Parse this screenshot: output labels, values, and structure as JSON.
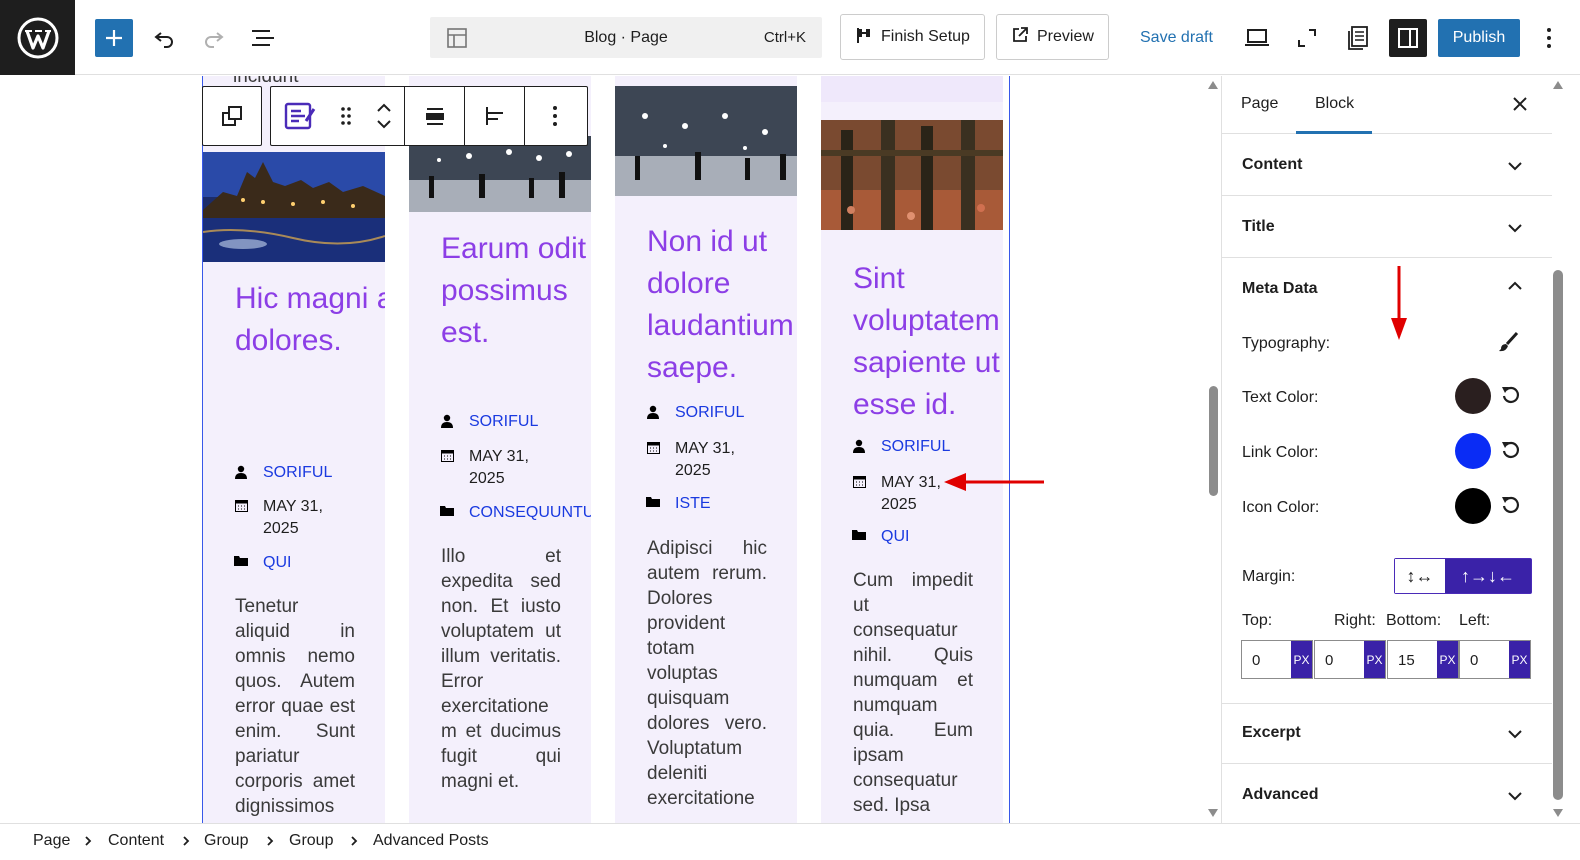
{
  "topbar": {
    "command_title": "Blog · Page",
    "command_shortcut": "Ctrl+K",
    "finish_setup_label": "Finish Setup",
    "preview_label": "Preview",
    "save_draft_label": "Save draft",
    "publish_label": "Publish"
  },
  "canvas": {
    "truncated_top_text": "incidunt",
    "posts": [
      {
        "title": "Hic magni ad dolores.",
        "author": "SORIFUL",
        "date": "MAY 31, 2025",
        "category": "QUI",
        "excerpt": "Tenetur aliquid in omnis nemo quos. Autem error quae est enim. Sunt pariatur corporis amet dignissimos"
      },
      {
        "title": "Earum odit in possimus est.",
        "author": "SORIFUL",
        "date": "MAY 31, 2025",
        "category": "CONSEQUUNTUR",
        "excerpt": "Illo et expedita sed non. Et iusto voluptatem ut illum veritatis. Error exercitatione m et ducimus fugit qui magni et."
      },
      {
        "title": "Non id ut dolore laudantium saepe.",
        "author": "SORIFUL",
        "date": "MAY 31, 2025",
        "category": "ISTE",
        "excerpt": "Adipisci hic autem rerum. Dolores provident totam voluptas quisquam dolores vero. Voluptatum deleniti exercitatione"
      },
      {
        "title": "Sint voluptatem sapiente ut esse id.",
        "author": "SORIFUL",
        "date": "MAY 31, 2025",
        "category": "QUI",
        "excerpt": "Cum impedit ut consequatur nihil. Quis numquam et numquam quia. Eum ipsam consequatur sed. Ipsa"
      }
    ]
  },
  "sidebar": {
    "tabs": [
      "Page",
      "Block"
    ],
    "active_tab": "Block",
    "panels": {
      "content": "Content",
      "title": "Title",
      "meta_data": "Meta Data",
      "excerpt": "Excerpt",
      "advanced": "Advanced"
    },
    "meta": {
      "typography_label": "Typography:",
      "text_color_label": "Text Color:",
      "text_color": "#2a1f1f",
      "link_color_label": "Link Color:",
      "link_color": "#0a2cf5",
      "icon_color_label": "Icon Color:",
      "icon_color": "#000000",
      "margin_label": "Margin:",
      "margin": {
        "top_label": "Top:",
        "right_label": "Right:",
        "bottom_label": "Bottom:",
        "left_label": "Left:",
        "top": "0",
        "right": "0",
        "bottom": "15",
        "left": "0",
        "unit": "PX"
      }
    }
  },
  "breadcrumb": [
    "Page",
    "Content",
    "Group",
    "Group",
    "Advanced Posts"
  ],
  "colors": {
    "accent": "#2271b1",
    "title_purple": "#8c3ee6",
    "link_blue": "#1a3ae0",
    "card_bg": "#f4f0fc",
    "toggle_purple": "#3a22a8",
    "annotation_red": "#e00000"
  }
}
